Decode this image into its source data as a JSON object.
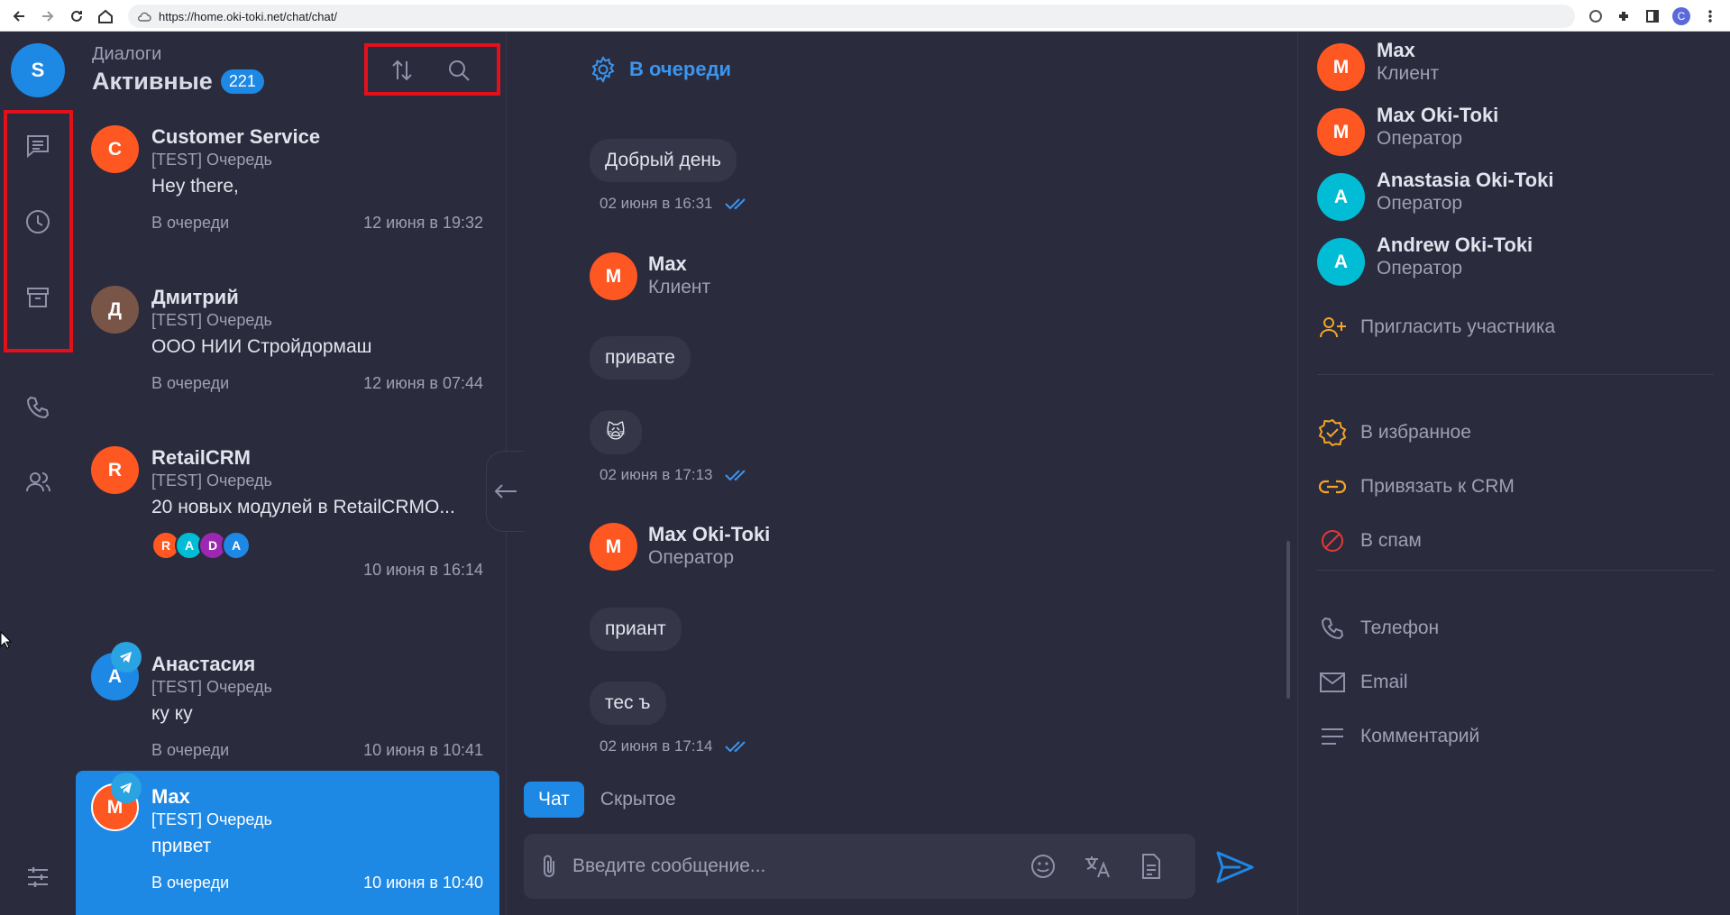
{
  "browser": {
    "url": "https://home.oki-toki.net/chat/chat/",
    "profile_initial": "C"
  },
  "rail": {
    "user_initial": "S"
  },
  "list": {
    "kicker": "Диалоги",
    "title": "Активные",
    "count": "221",
    "dialogs": [
      {
        "initial": "C",
        "name": "Customer Service",
        "queue": "[TEST] Очередь",
        "message": "Hey there,",
        "status": "В очереди",
        "time": "12 июня в 19:32",
        "avatar_color": "#ff5722"
      },
      {
        "initial": "Д",
        "name": "Дмитрий",
        "queue": "[TEST] Очередь",
        "message": "ООО НИИ Стройдормаш",
        "status": "В очереди",
        "time": "12 июня в 07:44",
        "avatar_color": "#795548"
      },
      {
        "initial": "R",
        "name": "RetailCRM",
        "queue": "[TEST] Очередь",
        "message": "20 новых модулей в RetailCRMО...",
        "status": "",
        "time": "10 июня в 16:14",
        "avatar_color": "#ff5722",
        "participants": [
          {
            "initial": "R",
            "color": "#ff5722"
          },
          {
            "initial": "A",
            "color": "#00bcd4"
          },
          {
            "initial": "D",
            "color": "#9c27b0"
          },
          {
            "initial": "A",
            "color": "#1e88e5"
          }
        ]
      },
      {
        "initial": "A",
        "name": "Анастасия",
        "queue": "[TEST] Очередь",
        "message": "ку ку",
        "status": "В очереди",
        "time": "10 июня в 10:41",
        "avatar_color": "#1e88e5"
      },
      {
        "initial": "M",
        "name": "Max",
        "queue": "[TEST] Очередь",
        "message": "привет",
        "status": "В очереди",
        "time": "10 июня в 10:40",
        "avatar_color": "#ff5722"
      }
    ]
  },
  "chat": {
    "header_status": "В очереди",
    "messages": {
      "m1": "Добрый день",
      "t1": "02 июня в 16:31",
      "sender1_initial": "M",
      "sender1_name": "Max",
      "sender1_role": "Клиент",
      "m2": "привате",
      "m3": "🙀",
      "t2": "02 июня в 17:13",
      "sender2_initial": "M",
      "sender2_name": "Max Oki-Toki",
      "sender2_role": "Оператор",
      "m4": "приант",
      "m5": "тес ъ",
      "t3": "02 июня в 17:14"
    },
    "tabs": [
      "Чат",
      "Скрытое"
    ],
    "input_placeholder": "Введите сообщение..."
  },
  "side": {
    "members": [
      {
        "initial": "M",
        "name": "Max",
        "role": "Клиент",
        "color": "#ff5722"
      },
      {
        "initial": "M",
        "name": "Max Oki-Toki",
        "role": "Оператор",
        "color": "#ff5722"
      },
      {
        "initial": "A",
        "name": "Anastasia Oki-Toki",
        "role": "Оператор",
        "color": "#00bcd4"
      },
      {
        "initial": "A",
        "name": "Andrew Oki-Toki",
        "role": "Оператор",
        "color": "#00bcd4"
      }
    ],
    "invite": "Пригласить участника",
    "favorite": "В избранное",
    "crm": "Привязать к CRM",
    "spam": "В спам",
    "phone": "Телефон",
    "email": "Email",
    "comment": "Комментарий"
  },
  "colors": {
    "accent": "#1e88e5",
    "background": "#2a2b3d",
    "highlight_box": "#e2101b",
    "orange_icon": "#f5a623",
    "spam_red": "#e53935"
  }
}
